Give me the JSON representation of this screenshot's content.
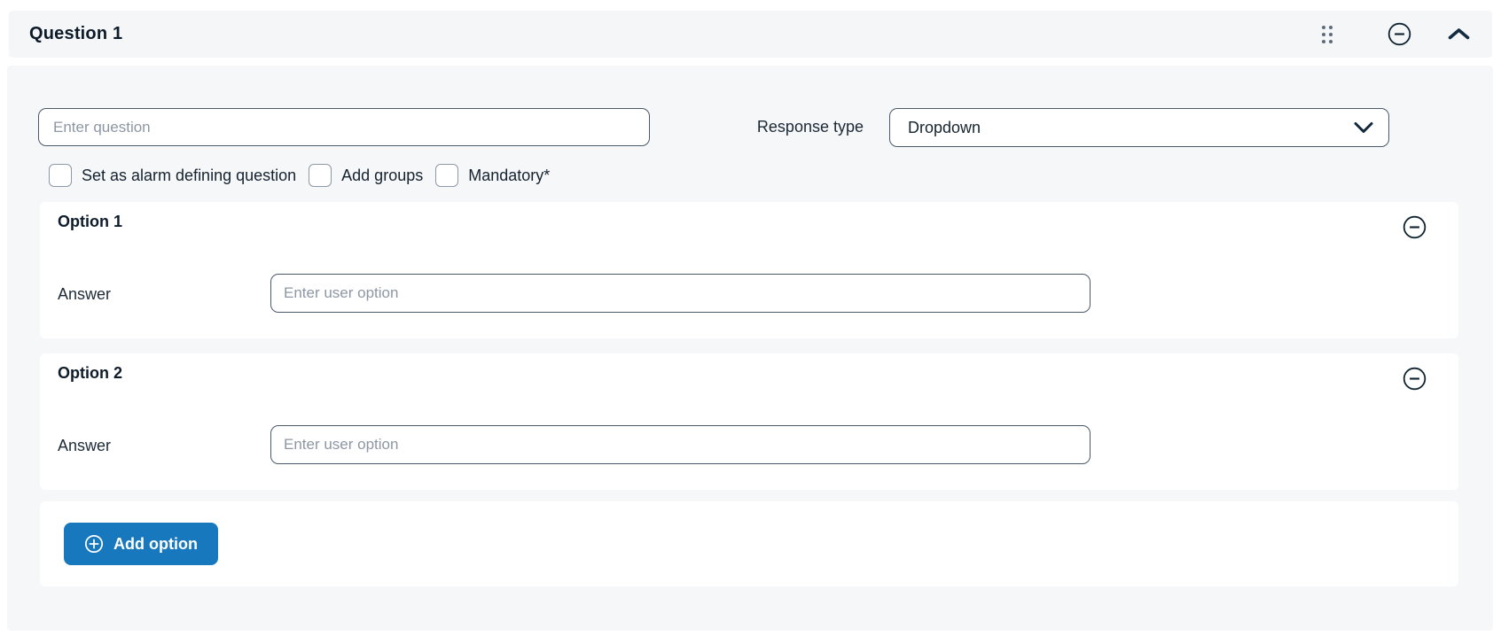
{
  "header": {
    "title": "Question 1",
    "drag_icon": "drag-handle",
    "remove_icon": "minus-circle",
    "collapse_icon": "chevron-up"
  },
  "question": {
    "placeholder": "Enter question",
    "value": "",
    "response_type_label": "Response type",
    "response_type_value": "Dropdown",
    "checkboxes": [
      {
        "label": "Set as alarm defining question",
        "checked": false
      },
      {
        "label": "Add groups",
        "checked": false
      },
      {
        "label": "Mandatory*",
        "checked": false
      }
    ]
  },
  "options": [
    {
      "title": "Option 1",
      "answer_label": "Answer",
      "placeholder": "Enter user option",
      "value": "",
      "remove_icon": "minus-circle"
    },
    {
      "title": "Option 2",
      "answer_label": "Answer",
      "placeholder": "Enter user option",
      "value": "",
      "remove_icon": "minus-circle"
    }
  ],
  "add_option": {
    "label": "Add option",
    "icon": "plus-circle"
  },
  "colors": {
    "accent_blue": "#1878be",
    "dark_navy": "#0e1c2a",
    "input_border": "#4a5a6b",
    "checkbox_border": "#8d99a6",
    "placeholder": "#8d97a3",
    "header_bg": "#f5f6f8",
    "card_bg": "#f6f7f9",
    "option_bg": "#ffffff"
  }
}
